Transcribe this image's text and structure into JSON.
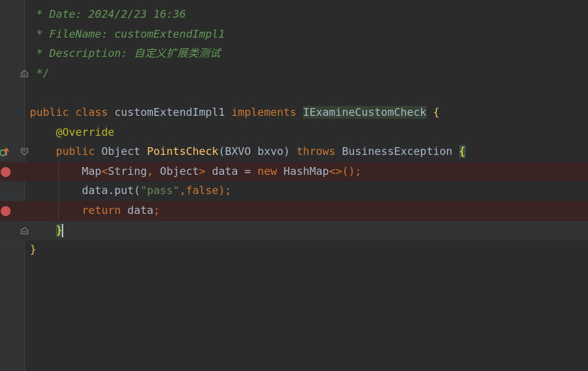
{
  "editor": {
    "lines": [
      {
        "segments": [
          {
            "t": " * Date: 2024/2/23 16:36",
            "c": "tok-comment"
          }
        ]
      },
      {
        "segments": [
          {
            "t": " * FileName: customExtendImpl1",
            "c": "tok-comment"
          }
        ]
      },
      {
        "segments": [
          {
            "t": " * Description: 自定义扩展类测试",
            "c": "tok-comment"
          }
        ]
      },
      {
        "segments": [
          {
            "t": " */",
            "c": "tok-comment"
          }
        ]
      },
      {
        "segments": []
      },
      {
        "segments": [
          {
            "t": "public ",
            "c": "tok-kw"
          },
          {
            "t": "class ",
            "c": "tok-kw"
          },
          {
            "t": "customExtendImpl1 ",
            "c": "tok-cls"
          },
          {
            "t": "implements ",
            "c": "tok-kw"
          },
          {
            "t": "IExamineCustomCheck",
            "c": "tok-hl"
          },
          {
            "t": " {",
            "c": "tok-brace"
          }
        ]
      },
      {
        "segments": [
          {
            "t": "    ",
            "c": "tok-plain"
          },
          {
            "t": "@Override",
            "c": "tok-ann"
          }
        ]
      },
      {
        "segments": [
          {
            "t": "    ",
            "c": "tok-plain"
          },
          {
            "t": "public ",
            "c": "tok-kw"
          },
          {
            "t": "Object ",
            "c": "tok-cls"
          },
          {
            "t": "PointsCheck",
            "c": "tok-fn"
          },
          {
            "t": "(BXVO bxvo) ",
            "c": "tok-plain"
          },
          {
            "t": "throws ",
            "c": "tok-kw"
          },
          {
            "t": "BusinessException ",
            "c": "tok-cls"
          },
          {
            "t": "{",
            "c": "tok-brace-hl"
          }
        ]
      },
      {
        "segments": [
          {
            "t": "        Map",
            "c": "tok-plain"
          },
          {
            "t": "<",
            "c": "tok-punct"
          },
          {
            "t": "String",
            "c": "tok-plain"
          },
          {
            "t": ", ",
            "c": "tok-punct"
          },
          {
            "t": "Object",
            "c": "tok-plain"
          },
          {
            "t": "> ",
            "c": "tok-punct"
          },
          {
            "t": "data = ",
            "c": "tok-plain"
          },
          {
            "t": "new ",
            "c": "tok-kw"
          },
          {
            "t": "HashMap",
            "c": "tok-plain"
          },
          {
            "t": "<>();",
            "c": "tok-punct"
          }
        ]
      },
      {
        "segments": [
          {
            "t": "        data.put(",
            "c": "tok-plain"
          },
          {
            "t": "\"pass\"",
            "c": "tok-str"
          },
          {
            "t": ",",
            "c": "tok-punct"
          },
          {
            "t": "false",
            "c": "tok-kw"
          },
          {
            "t": ");",
            "c": "tok-punct"
          }
        ]
      },
      {
        "segments": [
          {
            "t": "        ",
            "c": "tok-plain"
          },
          {
            "t": "return ",
            "c": "tok-kw"
          },
          {
            "t": "data",
            "c": "tok-plain"
          },
          {
            "t": ";",
            "c": "tok-punct"
          }
        ]
      },
      {
        "segments": [
          {
            "t": "    ",
            "c": "tok-plain"
          },
          {
            "t": "}",
            "c": "tok-brace-hl"
          }
        ]
      },
      {
        "segments": [
          {
            "t": "}",
            "c": "tok-brace"
          }
        ]
      }
    ]
  },
  "colors": {
    "background": "#2b2b2b",
    "gutter": "#313335",
    "breakpoint": "#c75450",
    "breakpoint_line": "#3a2323",
    "keyword": "#cc7832",
    "comment": "#629755",
    "string": "#6a8759",
    "annotation": "#bbb529",
    "method": "#ffc66d"
  },
  "icons": {
    "breakpoint": "breakpoint-icon",
    "fold": "fold-icon",
    "override": "override-gutter-icon"
  }
}
